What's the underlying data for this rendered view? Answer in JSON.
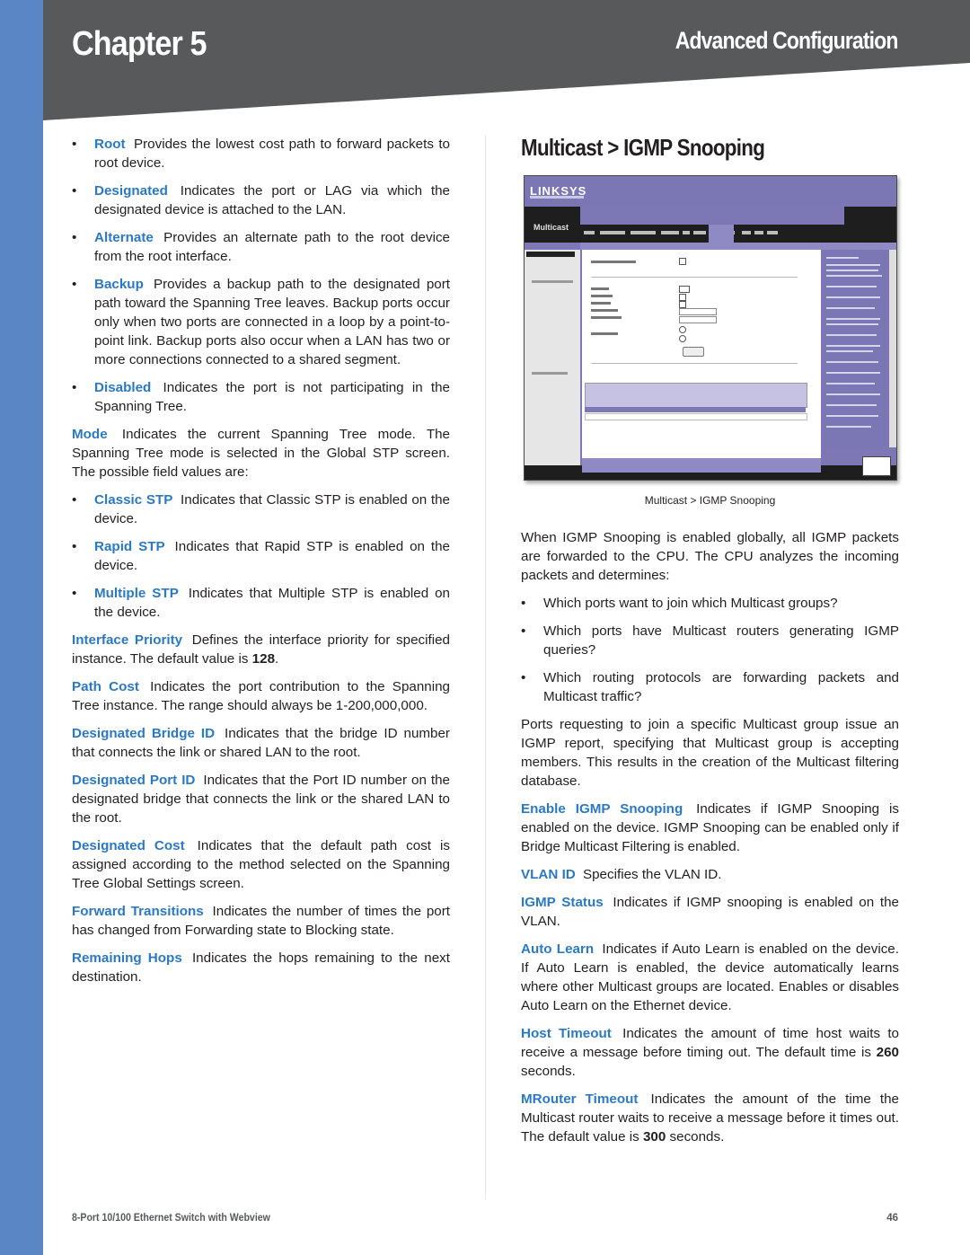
{
  "header": {
    "chapter": "Chapter 5",
    "section": "Advanced Configuration"
  },
  "colors": {
    "accent_blue": "#2b79c2",
    "side_bar": "#5b86c5",
    "header_gray": "#58595b"
  },
  "left": {
    "port_role_bullets": [
      {
        "term": "Root",
        "text": "Provides the lowest cost path to forward packets to root device."
      },
      {
        "term": "Designated",
        "text": "Indicates the port or LAG via which the designated device is attached to the LAN."
      },
      {
        "term": "Alternate",
        "text": "Provides an alternate path to the root device from the root interface."
      },
      {
        "term": "Backup",
        "text": "Provides a backup path to the designated port path toward the Spanning Tree leaves. Backup ports occur only when two ports are connected in a loop by a point-to-point link. Backup ports also occur when a LAN has two or more connections connected to a shared segment."
      },
      {
        "term": "Disabled",
        "text": "Indicates the port is not participating in the Spanning Tree."
      }
    ],
    "mode": {
      "term": "Mode",
      "text": "Indicates the current Spanning Tree mode. The Spanning Tree mode is selected in the Global STP screen. The possible field values are:"
    },
    "mode_bullets": [
      {
        "term": "Classic STP",
        "text": "Indicates that Classic STP is enabled on the device."
      },
      {
        "term": "Rapid STP",
        "text": "Indicates that Rapid STP is enabled on the device."
      },
      {
        "term": "Multiple STP",
        "text": "Indicates that Multiple STP is enabled on the device."
      }
    ],
    "interface_priority": {
      "term": "Interface Priority",
      "text": "Defines the interface priority for specified instance. The default value is",
      "value": "128",
      "end": "."
    },
    "fields": [
      {
        "term": "Path Cost",
        "text": "Indicates the port contribution to the Spanning Tree instance. The range should always be 1-200,000,000."
      },
      {
        "term": "Designated Bridge ID",
        "text": "Indicates that the bridge ID number that connects the link or shared LAN to the root."
      },
      {
        "term": "Designated Port ID",
        "text": "Indicates that the Port ID number on the designated bridge that connects the link or the shared LAN to the root."
      },
      {
        "term": "Designated Cost",
        "text": "Indicates that the default path cost is assigned according to the method selected on the Spanning Tree Global Settings screen."
      },
      {
        "term": "Forward Transitions",
        "text": "Indicates the number of times the port has changed from Forwarding state to Blocking state."
      },
      {
        "term": "Remaining Hops",
        "text": "Indicates the hops remaining to the next destination."
      }
    ]
  },
  "right": {
    "heading": "Multicast > IGMP Snooping",
    "figure": {
      "logo": "LINKSYS",
      "page_label": "Multicast",
      "caption": "Multicast > IGMP Snooping"
    },
    "intro": "When IGMP Snooping is enabled globally, all IGMP packets are forwarded to the CPU. The CPU analyzes the incoming packets and determines:",
    "questions": [
      "Which ports want to join which Multicast groups?",
      "Which ports have Multicast routers generating IGMP queries?",
      "Which routing protocols are forwarding packets and Multicast traffic?"
    ],
    "ports_paragraph": "Ports requesting to join a specific Multicast group issue an IGMP report, specifying that Multicast group is accepting members. This results in the creation of the Multicast filtering database.",
    "fields": [
      {
        "term": "Enable IGMP Snooping",
        "text": "Indicates if IGMP Snooping is enabled on the device. IGMP Snooping can be enabled only if Bridge Multicast Filtering is enabled."
      },
      {
        "term": "VLAN ID",
        "text": "Specifies the VLAN ID."
      },
      {
        "term": "IGMP Status",
        "text": "Indicates if IGMP snooping is enabled on the VLAN."
      },
      {
        "term": "Auto Learn",
        "text": "Indicates if Auto Learn is enabled on the device. If Auto Learn is enabled, the device automatically learns where other Multicast groups are located. Enables or disables Auto Learn on the Ethernet device."
      }
    ],
    "host_timeout": {
      "term": "Host Timeout",
      "text": "Indicates the amount of time host waits to receive a message before timing out. The default time is",
      "value": "260",
      "end": "seconds."
    },
    "mrouter_timeout": {
      "term": "MRouter Timeout",
      "text": "Indicates the amount of the time the Multicast router waits to receive a message before it times out. The default value is",
      "value": "300",
      "end": "seconds."
    }
  },
  "footer": {
    "product": "8-Port 10/100 Ethernet Switch with Webview",
    "page_number": "46"
  }
}
